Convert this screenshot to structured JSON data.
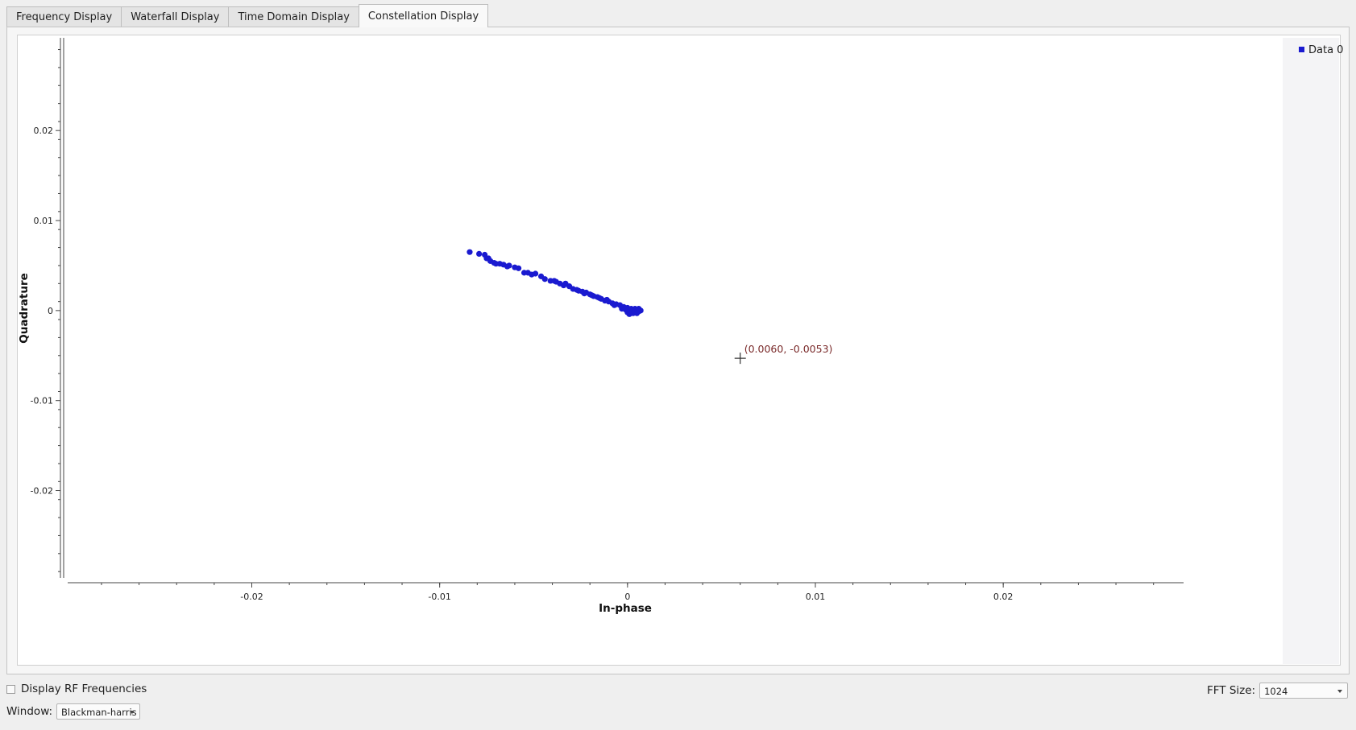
{
  "tabs": [
    {
      "label": "Frequency Display",
      "active": false
    },
    {
      "label": "Waterfall Display",
      "active": false
    },
    {
      "label": "Time Domain Display",
      "active": false
    },
    {
      "label": "Constellation Display",
      "active": true
    }
  ],
  "legend": {
    "label": "Data 0",
    "color": "#1a1ad0"
  },
  "cursor_readout": "(0.0060, -0.0053)",
  "controls": {
    "display_rf_label": "Display RF Frequencies",
    "display_rf_checked": false,
    "window_label": "Window:",
    "window_value": "Blackman-harris",
    "fft_label": "FFT Size:",
    "fft_value": "1024"
  },
  "chart_data": {
    "type": "scatter",
    "xlabel": "In-phase",
    "ylabel": "Quadrature",
    "xlim": [
      -0.0298,
      0.0296
    ],
    "ylim": [
      -0.0297,
      0.0303
    ],
    "xticks": [
      {
        "value": -0.02,
        "label": "-0.02"
      },
      {
        "value": -0.01,
        "label": "-0.01"
      },
      {
        "value": 0,
        "label": "0"
      },
      {
        "value": 0.01,
        "label": "0.01"
      },
      {
        "value": 0.02,
        "label": "0.02"
      }
    ],
    "yticks": [
      {
        "value": 0.02,
        "label": "0.02"
      },
      {
        "value": 0.01,
        "label": "0.01"
      },
      {
        "value": 0,
        "label": "0"
      },
      {
        "value": -0.01,
        "label": "-0.01"
      },
      {
        "value": -0.02,
        "label": "-0.02"
      }
    ],
    "grid": false,
    "legend_position": "top-right",
    "cursor": {
      "x": 0.006,
      "y": -0.0053
    },
    "series": [
      {
        "name": "Data 0",
        "color": "#1a1ad0",
        "points": [
          [
            -0.0084,
            0.0065
          ],
          [
            -0.0079,
            0.0063
          ],
          [
            -0.0076,
            0.0062
          ],
          [
            -0.0074,
            0.0058
          ],
          [
            -0.0073,
            0.0055
          ],
          [
            -0.0071,
            0.0053
          ],
          [
            -0.0068,
            0.0052
          ],
          [
            -0.0066,
            0.0051
          ],
          [
            -0.0063,
            0.005
          ],
          [
            -0.006,
            0.0048
          ],
          [
            -0.0058,
            0.0047
          ],
          [
            -0.0053,
            0.0042
          ],
          [
            -0.0051,
            0.004
          ],
          [
            -0.0049,
            0.0041
          ],
          [
            -0.0046,
            0.0038
          ],
          [
            -0.0044,
            0.0035
          ],
          [
            -0.0041,
            0.0033
          ],
          [
            -0.0038,
            0.0032
          ],
          [
            -0.0036,
            0.003
          ],
          [
            -0.0034,
            0.0028
          ],
          [
            -0.0031,
            0.0027
          ],
          [
            -0.0029,
            0.0024
          ],
          [
            -0.0026,
            0.0022
          ],
          [
            -0.0024,
            0.0021
          ],
          [
            -0.0022,
            0.002
          ],
          [
            -0.002,
            0.0018
          ],
          [
            -0.0018,
            0.0016
          ],
          [
            -0.0016,
            0.0015
          ],
          [
            -0.0014,
            0.0013
          ],
          [
            -0.0012,
            0.0011
          ],
          [
            -0.001,
            0.001
          ],
          [
            -0.0008,
            0.0008
          ],
          [
            -0.0006,
            0.0007
          ],
          [
            -0.0004,
            0.0006
          ],
          [
            -0.0002,
            0.0004
          ],
          [
            0.0,
            0.0003
          ],
          [
            0.0001,
            0.0001
          ],
          [
            0.0002,
            -0.0001
          ],
          [
            0.0003,
            0.0
          ],
          [
            0.0004,
            -0.0002
          ],
          [
            0.0005,
            0.0001
          ],
          [
            0.0006,
            -0.0001
          ],
          [
            0.0007,
            0.0
          ],
          [
            0.0002,
            0.0002
          ],
          [
            0.0004,
            0.0002
          ],
          [
            0.0,
            -0.0002
          ],
          [
            0.0003,
            -0.0003
          ],
          [
            -0.0001,
            0.0001
          ],
          [
            0.0006,
            0.0002
          ],
          [
            0.0005,
            -0.0003
          ],
          [
            0.0001,
            -0.0004
          ],
          [
            -0.0003,
            0.0002
          ],
          [
            -0.0007,
            0.0006
          ],
          [
            -0.0011,
            0.0012
          ],
          [
            -0.0015,
            0.0014
          ],
          [
            -0.0019,
            0.0017
          ],
          [
            -0.0023,
            0.0019
          ],
          [
            -0.0027,
            0.0023
          ],
          [
            -0.0033,
            0.003
          ],
          [
            -0.0039,
            0.0033
          ],
          [
            -0.0055,
            0.0042
          ],
          [
            -0.0064,
            0.0049
          ],
          [
            -0.007,
            0.0052
          ],
          [
            -0.0075,
            0.0058
          ]
        ]
      }
    ]
  }
}
